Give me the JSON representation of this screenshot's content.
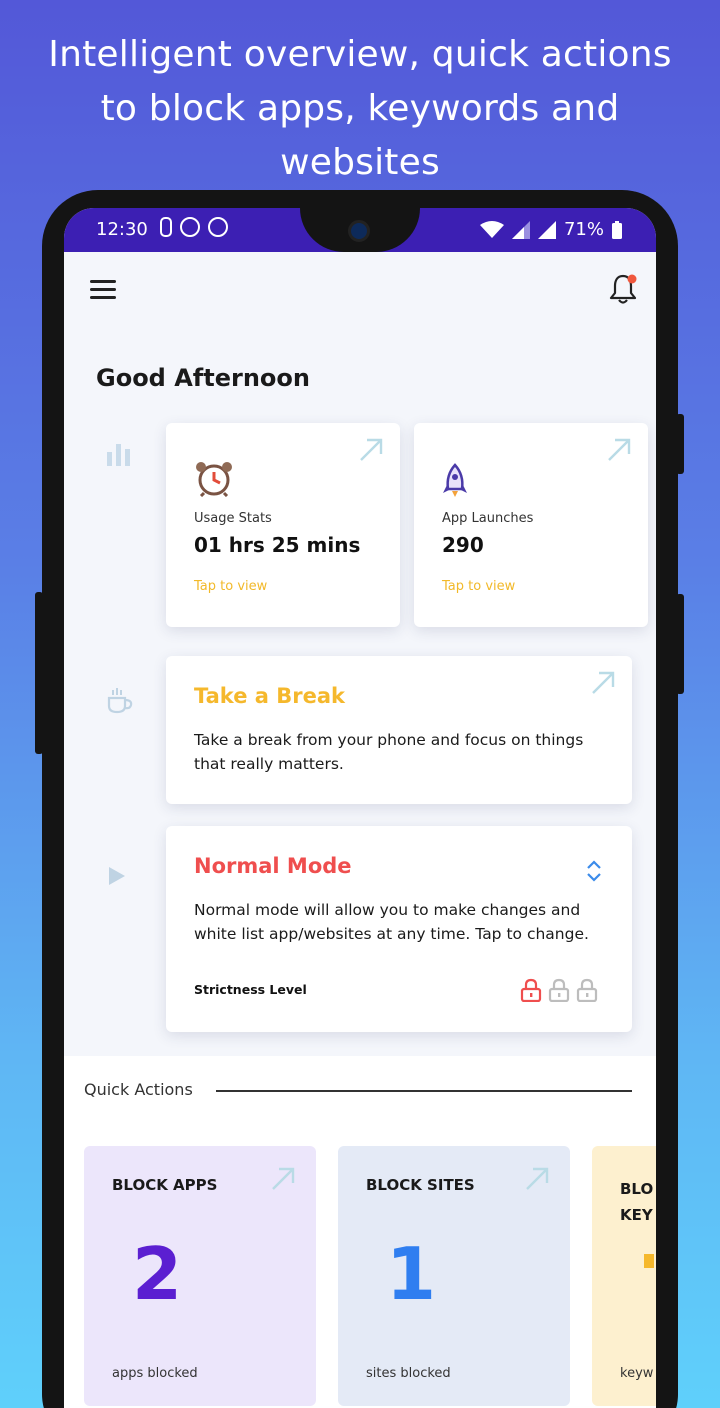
{
  "headline": {
    "line1": "Intelligent overview, quick actions",
    "line2": "to block apps, keywords and",
    "line3": "websites"
  },
  "status_bar": {
    "time": "12:30",
    "battery": "71%"
  },
  "greeting": "Good Afternoon",
  "stats": [
    {
      "label": "Usage Stats",
      "value": "01 hrs 25 mins",
      "link": "Tap to view",
      "icon": "alarm-clock-icon"
    },
    {
      "label": "App Launches",
      "value": "290",
      "link": "Tap to view",
      "icon": "rocket-icon"
    }
  ],
  "take_break": {
    "title": "Take a Break",
    "body": "Take a break from your phone and focus on things that really matters."
  },
  "mode": {
    "title": "Normal Mode",
    "body": "Normal mode will allow you to make changes and white list app/websites at any time. Tap to change.",
    "strictness_label": "Strictness Level"
  },
  "quick_actions": {
    "title": "Quick Actions",
    "cards": [
      {
        "title": "BLOCK APPS",
        "count": "2",
        "sub": "apps blocked"
      },
      {
        "title": "BLOCK SITES",
        "count": "1",
        "sub": "sites blocked"
      },
      {
        "title": "BLO",
        "title2": "KEY",
        "count": "",
        "sub": "keyw"
      }
    ]
  },
  "colors": {
    "status_bar": "#3c1fb3",
    "take_break_title": "#f5b82c",
    "normal_mode_title": "#ef4e4e",
    "block_apps_count": "#5b1fd1",
    "block_sites_count": "#2f7ef0",
    "link": "#f2b92a"
  }
}
